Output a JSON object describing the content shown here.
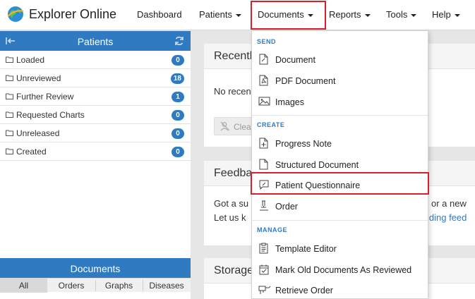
{
  "app": {
    "title": "Explorer Online"
  },
  "nav": {
    "dashboard": "Dashboard",
    "patients": "Patients",
    "documents": "Documents",
    "reports": "Reports",
    "tools": "Tools",
    "help": "Help"
  },
  "patients_panel": {
    "title": "Patients",
    "items": [
      {
        "label": "Loaded",
        "count": "0"
      },
      {
        "label": "Unreviewed",
        "count": "18"
      },
      {
        "label": "Further Review",
        "count": "1"
      },
      {
        "label": "Requested Charts",
        "count": "0"
      },
      {
        "label": "Unreleased",
        "count": "0"
      },
      {
        "label": "Created",
        "count": "0"
      }
    ]
  },
  "documents_panel": {
    "title": "Documents",
    "tabs": [
      "All",
      "Orders",
      "Graphs",
      "Diseases"
    ],
    "active_tab": "All"
  },
  "content": {
    "recent_title": "Recentl",
    "recent_text": "No recen",
    "clear_label": "Clea",
    "feedback_title": "Feedba",
    "feedback_line1_left": "Got a su",
    "feedback_line1_right": "or a new",
    "feedback_line2_left": "Let us k",
    "feedback_link": "iding feed",
    "storage_title": "Storage"
  },
  "documents_menu": {
    "sections": {
      "send": "SEND",
      "create": "CREATE",
      "manage": "MANAGE"
    },
    "send_items": [
      "Document",
      "PDF Document",
      "Images"
    ],
    "create_items": [
      "Progress Note",
      "Structured Document",
      "Patient Questionnaire",
      "Order"
    ],
    "manage_items": [
      "Template Editor",
      "Mark Old Documents As Reviewed",
      "Retrieve Order"
    ],
    "highlighted_item": "Patient Questionnaire"
  },
  "colors": {
    "accent": "#2f7ac1",
    "highlight_border": "#d9202a"
  }
}
